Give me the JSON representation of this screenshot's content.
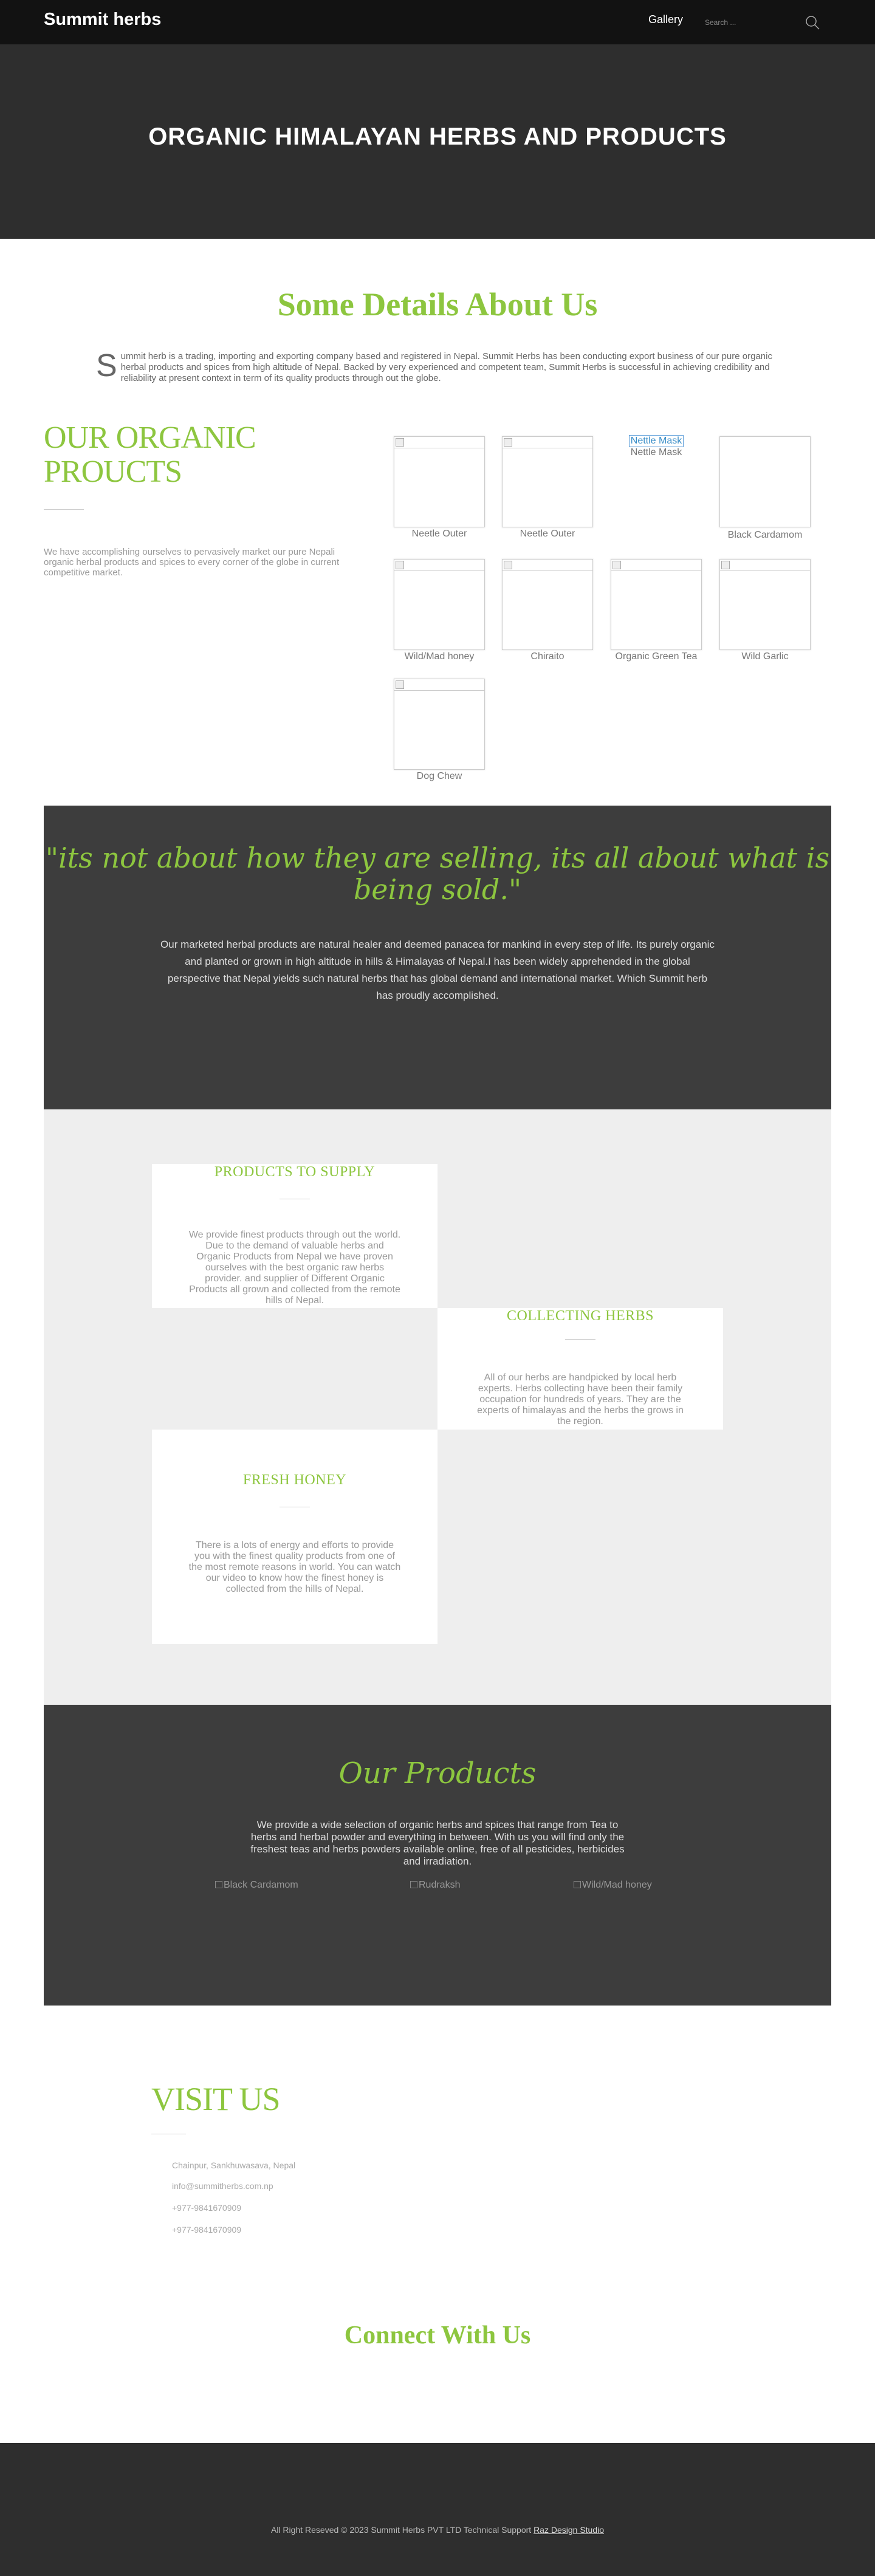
{
  "nav": {
    "brand": "Summit herbs",
    "gallery": "Gallery",
    "search_placeholder": "Search ...",
    "search_icon": "search-icon"
  },
  "hero": {
    "title": "ORGANIC HIMALAYAN HERBS AND PRODUCTS"
  },
  "about": {
    "title": "Some Details About Us",
    "dropcap": "S",
    "text": "ummit herb is a trading, importing and exporting company based and registered in Nepal. Summit Herbs has been conducting export business of our pure organic herbal products and spices from high altitude of Nepal. Backed by very experienced and competent team, Summit Herbs is successful in achieving credibility and reliability at present context in term of its quality products through out the globe."
  },
  "organic": {
    "title": "OUR ORGANIC PROUCTS",
    "text": "We have accomplishing ourselves to pervasively market our pure Nepali organic herbal products and spices to every corner of the globe in current competitive market."
  },
  "products": [
    {
      "label": "Neetle Outer"
    },
    {
      "label": "Neetle Outer"
    },
    {
      "label": "Nettle Mask",
      "link": "Nettle Mask"
    },
    {
      "label": "Black Cardamom"
    },
    {
      "label": "Wild/Mad honey"
    },
    {
      "label": "Chiraito"
    },
    {
      "label": "Organic Green Tea"
    },
    {
      "label": "Wild Garlic"
    },
    {
      "label": "Dog Chew"
    }
  ],
  "quote": {
    "text": "\"its not about how they are selling, its all about what is being sold.\"",
    "body": "Our marketed herbal products are natural healer and deemed panacea for mankind in every step of life. Its purely organic and planted or grown in high altitude in hills & Himalayas of Nepal.I has been widely apprehended in the global perspective that Nepal yields such natural herbs that has global demand and international market. Which Summit herb has proudly accomplished."
  },
  "services": [
    {
      "title": "PRODUCTS TO SUPPLY",
      "text": "We provide finest products through out the world. Due to the demand of  valuable herbs and Organic Products from Nepal we have proven ourselves with the best organic raw herbs provider. and supplier of Different Organic Products all grown and collected from the remote hills of Nepal."
    },
    {
      "title": "COLLECTING HERBS",
      "text": "All of our herbs are handpicked by local herb experts. Herbs collecting have been their family occupation for hundreds of years. They are the experts of himalayas and the herbs the grows in the region."
    },
    {
      "title": "FRESH HONEY",
      "text": "There is a lots of energy and efforts to provide you with the finest quality products from one of the most remote reasons in world. You can watch our video to know how the finest honey is collected from the hills of Nepal."
    }
  ],
  "our_products": {
    "title": "Our Products",
    "text": "We provide a wide selection of organic herbs and spices that range from Tea to herbs and herbal powder and everything in between. With us  you will find only the freshest teas and herbs powders available online, free of all pesticides, herbicides and irradiation.",
    "slides": [
      "Black Cardamom",
      "Rudraksh",
      "Wild/Mad honey"
    ],
    "prev": "",
    "next": ""
  },
  "visit": {
    "title": "VISIT US",
    "address": "Chainpur, Sankhuwasava, Nepal",
    "email": "info@summitherbs.com.np",
    "phone1": "+977-9841670909",
    "phone2": "+977-9841670909",
    "icon_glyph": ""
  },
  "connect": {
    "title": "Connect With Us"
  },
  "footer": {
    "text": "All Right Reseved © 2023 Summit Herbs PVT LTD Technical Support",
    "link": "Raz Design Studio"
  }
}
